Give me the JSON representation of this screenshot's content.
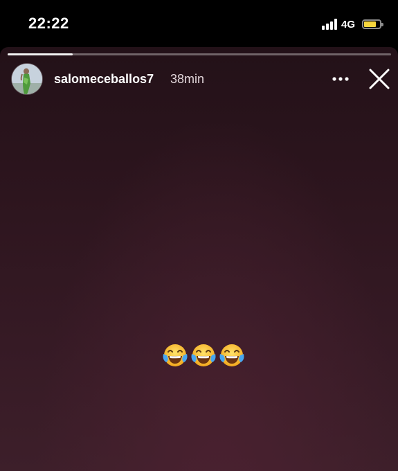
{
  "status_bar": {
    "time": "22:22",
    "network": "4G",
    "signal_bars": 4,
    "battery_level": 0.8,
    "battery_color": "#f6d53c"
  },
  "story": {
    "progress": 0.17,
    "username": "salomeceballos7",
    "time_ago": "38min",
    "avatar_icon": "profile-photo",
    "more_icon": "more-horizontal-icon",
    "close_icon": "close-icon",
    "background_color": "#2d151e",
    "content": {
      "emoji_name": "face-with-tears-of-joy",
      "emoji_count": 3
    }
  }
}
